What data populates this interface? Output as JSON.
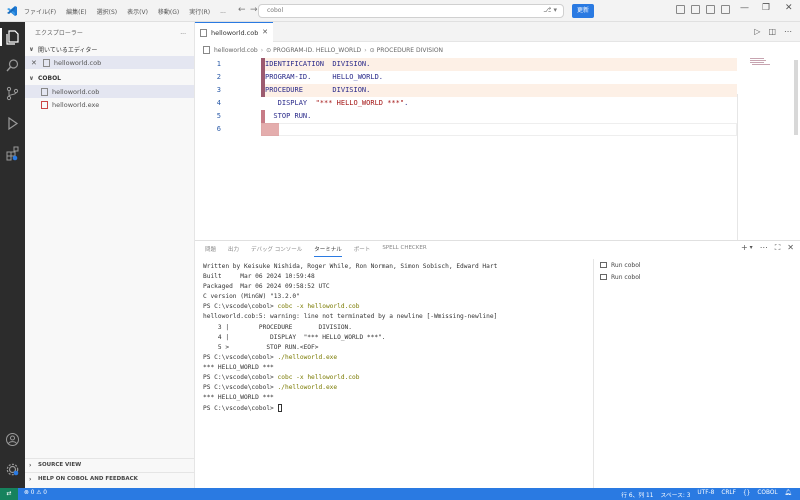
{
  "titlebar": {
    "menus": [
      "ファイル(F)",
      "編集(E)",
      "選択(S)",
      "表示(V)",
      "移動(G)",
      "実行(R)"
    ],
    "more": "...",
    "search_text": "cobol",
    "update_label": "更新"
  },
  "sidebar": {
    "title": "エクスプローラー",
    "more": "...",
    "open_editors_label": "開いているエディター",
    "open_editors": [
      {
        "name": "helloworld.cob"
      }
    ],
    "folder_label": "COBOL",
    "files": [
      {
        "name": "helloworld.cob",
        "selected": true
      },
      {
        "name": "helloworld.exe",
        "selected": false
      }
    ],
    "source_view_label": "SOURCE VIEW",
    "help_label": "HELP ON COBOL AND FEEDBACK"
  },
  "editor": {
    "tab_label": "helloworld.cob",
    "breadcrumb": [
      "helloworld.cob",
      "PROGRAM-ID. HELLO_WORLD",
      "PROCEDURE DIVISION"
    ],
    "lines": [
      {
        "no": "1",
        "text": "IDENTIFICATION  DIVISION."
      },
      {
        "no": "2",
        "text": "PROGRAM-ID.     HELLO_WORLD."
      },
      {
        "no": "3",
        "text": "PROCEDURE       DIVISION."
      },
      {
        "no": "4",
        "pre": "   DISPLAY  ",
        "str": "\"*** HELLO_WORLD ***\"",
        "post": "."
      },
      {
        "no": "5",
        "text": "  STOP RUN."
      },
      {
        "no": "6",
        "text": ""
      }
    ]
  },
  "panel": {
    "tabs": [
      "問題",
      "出力",
      "デバッグ コンソール",
      "ターミナル",
      "ポート",
      "SPELL CHECKER"
    ],
    "active_tab": "ターミナル",
    "terminal_lines": [
      {
        "type": "text",
        "text": "Written by Keisuke Nishida, Roger While, Ron Norman, Simon Sobisch, Edward Hart"
      },
      {
        "type": "text",
        "text": "Built     Mar 06 2024 10:59:48"
      },
      {
        "type": "text",
        "text": "Packaged  Mar 06 2024 09:58:52 UTC"
      },
      {
        "type": "text",
        "text": "C version (MinGW) \"13.2.0\""
      },
      {
        "type": "cmd",
        "prompt": "PS C:\\vscode\\cobol> ",
        "cmd": "cobc -x helloworld.cob"
      },
      {
        "type": "text",
        "text": "helloworld.cob:5: warning: line not terminated by a newline [-Wmissing-newline]"
      },
      {
        "type": "text",
        "text": "    3 |        PROCEDURE       DIVISION."
      },
      {
        "type": "text",
        "text": "    4 |           DISPLAY  \"*** HELLO_WORLD ***\"."
      },
      {
        "type": "text",
        "text": "    5 >          STOP RUN.<EOF>"
      },
      {
        "type": "cmd",
        "prompt": "PS C:\\vscode\\cobol> ",
        "cmd": "./helloworld.exe"
      },
      {
        "type": "text",
        "text": "*** HELLO_WORLD ***"
      },
      {
        "type": "cmd",
        "prompt": "PS C:\\vscode\\cobol> ",
        "cmd": "cobc -x helloworld.cob"
      },
      {
        "type": "cmd",
        "prompt": "PS C:\\vscode\\cobol> ",
        "cmd": "./helloworld.exe"
      },
      {
        "type": "text",
        "text": "*** HELLO_WORLD ***"
      },
      {
        "type": "cursor",
        "prompt": "PS C:\\vscode\\cobol> "
      }
    ],
    "terminals": [
      {
        "name": "Run cobol",
        "selected": false
      },
      {
        "name": "Run cobol",
        "selected": false
      }
    ]
  },
  "statusbar": {
    "errors": "0",
    "warnings": "0",
    "position": "行 6、列 11",
    "spaces": "スペース: 3",
    "encoding": "UTF-8",
    "eol": "CRLF",
    "language": "COBOL"
  },
  "colors": {
    "accent": "#2a7ae2",
    "activity_bar": "#2c2c2c",
    "status_bar": "#2a7ae2"
  }
}
